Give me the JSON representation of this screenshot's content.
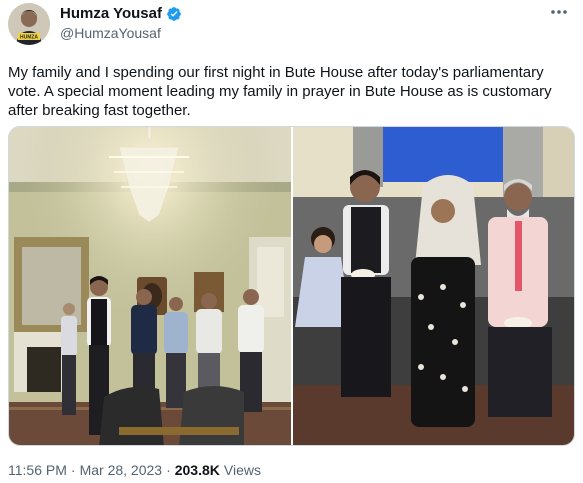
{
  "author": {
    "name": "Humza Yousaf",
    "handle": "@HumzaYousaf",
    "verified": true,
    "avatar_text": "HUMZA"
  },
  "tweet": {
    "text": "My family and I spending our first night in Bute House after today's parliamentary vote. A special moment leading my family in prayer in Bute House as is customary after breaking fast together."
  },
  "media": [
    {
      "icon": "photo",
      "description_hidden": true
    },
    {
      "icon": "photo",
      "description_hidden": true
    }
  ],
  "meta": {
    "time": "11:56 PM",
    "separator1": "·",
    "date": "Mar 28, 2023",
    "separator2": "·",
    "views_count": "203.8K",
    "views_label": "Views"
  },
  "colors": {
    "verified": "#1d9bf0",
    "secondary_text": "#536471",
    "primary_text": "#0f1419"
  }
}
